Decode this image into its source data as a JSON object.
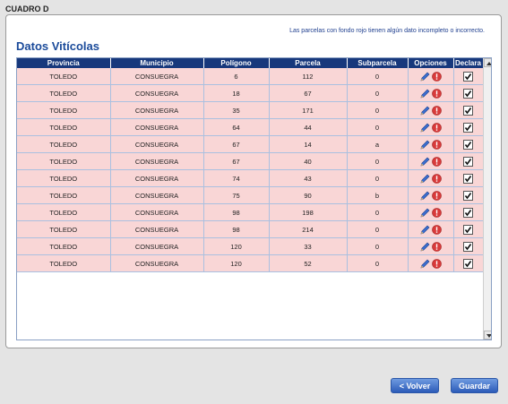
{
  "section_label": "CUADRO D",
  "notice": "Las parcelas con fondo rojo tienen algún dato incompleto o incorrecto.",
  "title": "Datos Vitícolas",
  "columns": [
    "Provincia",
    "Municipio",
    "Polígono",
    "Parcela",
    "Subparcela",
    "Opciones",
    "Declara"
  ],
  "rows": [
    [
      "TOLEDO",
      "CONSUEGRA",
      "6",
      "112",
      "0"
    ],
    [
      "TOLEDO",
      "CONSUEGRA",
      "18",
      "67",
      "0"
    ],
    [
      "TOLEDO",
      "CONSUEGRA",
      "35",
      "171",
      "0"
    ],
    [
      "TOLEDO",
      "CONSUEGRA",
      "64",
      "44",
      "0"
    ],
    [
      "TOLEDO",
      "CONSUEGRA",
      "67",
      "14",
      "a"
    ],
    [
      "TOLEDO",
      "CONSUEGRA",
      "67",
      "40",
      "0"
    ],
    [
      "TOLEDO",
      "CONSUEGRA",
      "74",
      "43",
      "0"
    ],
    [
      "TOLEDO",
      "CONSUEGRA",
      "75",
      "90",
      "b"
    ],
    [
      "TOLEDO",
      "CONSUEGRA",
      "98",
      "198",
      "0"
    ],
    [
      "TOLEDO",
      "CONSUEGRA",
      "98",
      "214",
      "0"
    ],
    [
      "TOLEDO",
      "CONSUEGRA",
      "120",
      "33",
      "0"
    ],
    [
      "TOLEDO",
      "CONSUEGRA",
      "120",
      "52",
      "0"
    ]
  ],
  "row_icons": [
    "edit-pencil-icon",
    "warning-exclamation-icon"
  ],
  "declara_checked": true,
  "colors": {
    "header_bg": "#17387c",
    "error_row_bg": "#f9d6d6",
    "title": "#1a4a9a",
    "button": "#2c5bb8"
  },
  "buttons": {
    "back": "< Volver",
    "save": "Guardar"
  }
}
